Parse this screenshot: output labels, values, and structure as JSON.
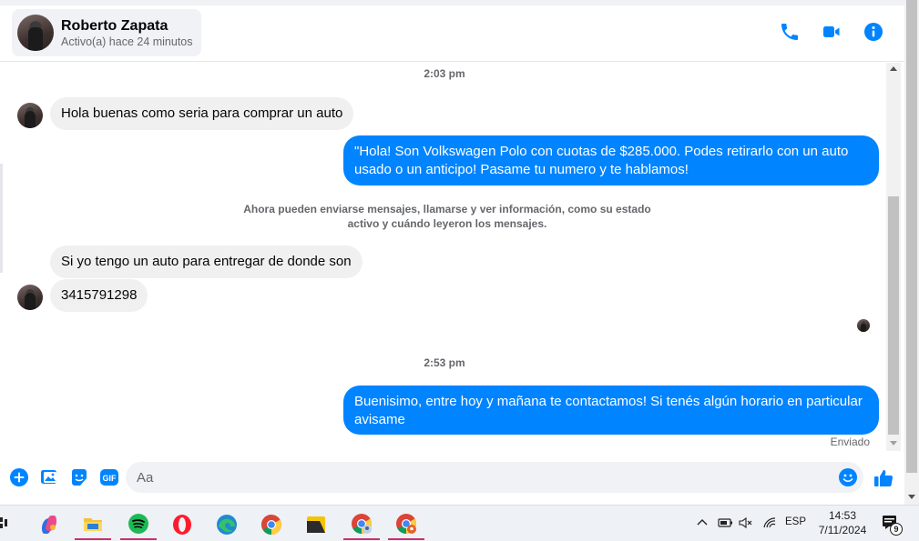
{
  "header": {
    "contact_name": "Roberto Zapata",
    "contact_status": "Activo(a) hace 24 minutos",
    "icons": [
      "phone-icon",
      "video-camera-icon",
      "info-icon"
    ]
  },
  "messages": {
    "timestamp_1": "2:03 pm",
    "incoming_1": "Hola buenas como seria para comprar un auto",
    "outgoing_1_line1": "\"Hola! Son Volkswagen Polo con cuotas de $285.000. Podes retirarlo con un auto",
    "outgoing_1_line2": "usado o un anticipo! Pasame tu numero y te hablamos!",
    "notice_line1": "Ahora pueden enviarse mensajes, llamarse y ver información, como su estado",
    "notice_line2": "activo y cuándo leyeron los mensajes.",
    "incoming_2": "Si yo tengo un auto para entregar de donde son",
    "incoming_3": "3415791298",
    "timestamp_2": "2:53 pm",
    "outgoing_2_line1": "Buenisimo, entre hoy y mañana te contactamos! Si tenés algún horario en particular",
    "outgoing_2_line2": "avisame",
    "sent_label": "Enviado"
  },
  "composer": {
    "placeholder": "Aa",
    "icons": [
      "add-icon",
      "image-icon",
      "sticker-icon",
      "gif-icon",
      "emoji-icon",
      "thumbs-up-icon"
    ],
    "gif_label": "GIF"
  },
  "taskbar": {
    "apps": [
      "copilot-icon",
      "file-explorer-icon",
      "spotify-icon",
      "opera-icon",
      "edge-icon",
      "chrome-icon",
      "sticky-notes-icon",
      "chrome-profile-icon",
      "chrome-profile-2-icon"
    ],
    "language": "ESP",
    "time": "14:53",
    "date": "7/11/2024",
    "notification_count": "9"
  },
  "colors": {
    "accent": "#0084ff",
    "incoming_bubble": "#f0f0f0"
  }
}
